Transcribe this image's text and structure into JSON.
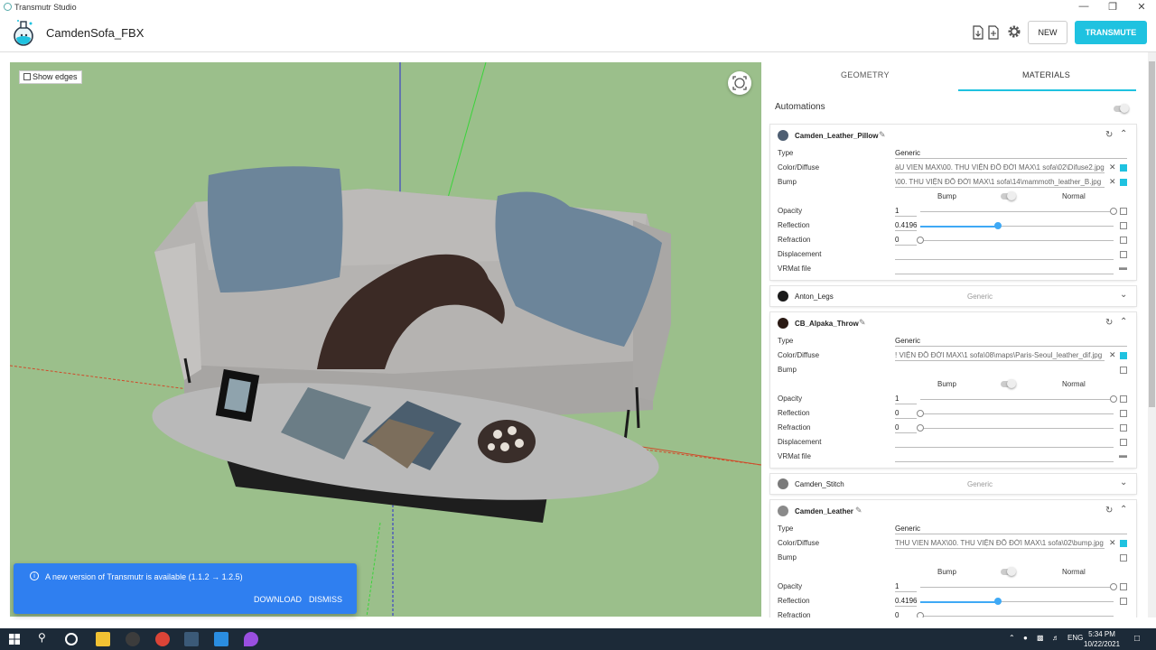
{
  "window": {
    "title": "Transmutr Studio"
  },
  "header": {
    "project_title": "CamdenSofa_FBX",
    "new_label": "NEW",
    "transmute_label": "TRANSMUTE"
  },
  "viewport": {
    "show_edges_label": "Show edges"
  },
  "toast": {
    "message": "A new version of Transmutr is available (1.1.2 → 1.2.5)",
    "download_label": "DOWNLOAD",
    "dismiss_label": "DISMISS"
  },
  "tabs": {
    "geometry": "GEOMETRY",
    "materials": "MATERIALS"
  },
  "automations_label": "Automations",
  "labels": {
    "type": "Type",
    "color_diffuse": "Color/Diffuse",
    "bump": "Bump",
    "opacity": "Opacity",
    "reflection": "Reflection",
    "refraction": "Refraction",
    "displacement": "Displacement",
    "vrmat_file": "VRMat file",
    "bump_toggle": "Bump",
    "normal_toggle": "Normal"
  },
  "materials": [
    {
      "name": "Camden_Leather_Pillow",
      "color": "#4e5e72",
      "type": "Generic",
      "color_diffuse": "àU VIEN MAX\\00. THU VIỆN ĐỒ ĐỜI MAX\\1 sofa\\02\\Difuse2.jpg",
      "bump": "\\00. THU VIỆN ĐỒ ĐỜI MAX\\1 sofa\\14\\mammoth_leather_B.jpg",
      "opacity": "1",
      "reflection": "0.4196",
      "reflection_level": 0.4196,
      "refraction": "0"
    },
    {
      "name": "Anton_Legs",
      "color": "#1a1a1a",
      "type": "Generic"
    },
    {
      "name": "CB_Alpaka_Throw",
      "color": "#2a1a14",
      "type": "Generic",
      "color_diffuse": "! VIỆN ĐỒ ĐỜI MAX\\1 sofa\\08\\maps\\Paris-Seoul_leather_dif.jpg",
      "opacity": "1",
      "reflection": "0",
      "refraction": "0"
    },
    {
      "name": "Camden_Stitch",
      "color": "#7a7a7a",
      "type": "Generic"
    },
    {
      "name": "Camden_Leather",
      "color": "#8a8a8a",
      "type": "Generic",
      "color_diffuse": "THU VIEN MAX\\00. THU VIỆN ĐỒ ĐỜI MAX\\1 sofa\\02\\bump.jpg",
      "opacity": "1",
      "reflection": "0.4196",
      "reflection_level": 0.4196,
      "refraction": "0"
    }
  ],
  "taskbar": {
    "lang": "ENG",
    "time": "5:34 PM",
    "date": "10/22/2021"
  },
  "colors": {
    "accent": "#1fc2e0",
    "viewport_bg": "#9bbf8b",
    "toast_bg": "#2f7ff0",
    "taskbar": "#1c2a38"
  }
}
